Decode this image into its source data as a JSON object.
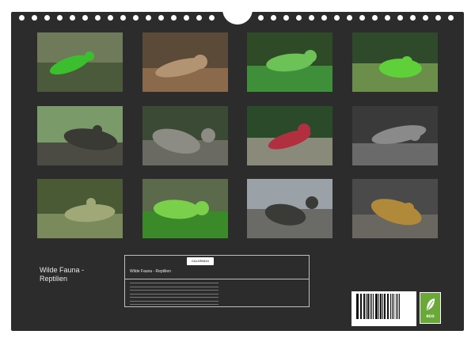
{
  "calendar": {
    "title_line1": "Wilde Fauna -",
    "title_line2": "Reptilien"
  },
  "photos": [
    {
      "caption": "",
      "subject": "green-gecko-on-branch",
      "palette": [
        "#6f7a5a",
        "#4a5a3a",
        "#3bbf2e"
      ]
    },
    {
      "caption": "",
      "subject": "tortoise-head",
      "palette": [
        "#5b4a38",
        "#8a6a4a",
        "#b39472"
      ]
    },
    {
      "caption": "",
      "subject": "green-iguana",
      "palette": [
        "#2f4a26",
        "#3f8f3a",
        "#6cc257"
      ]
    },
    {
      "caption": "",
      "subject": "green-lizard-on-leaf",
      "palette": [
        "#2e4a2a",
        "#6b8f4a",
        "#5fcf3a"
      ]
    },
    {
      "caption": "",
      "subject": "anole-on-rock",
      "palette": [
        "#7a9a6a",
        "#4b4b44",
        "#3a3a34"
      ]
    },
    {
      "caption": "",
      "subject": "alligator",
      "palette": [
        "#3a4a34",
        "#6a6a62",
        "#8c8c84"
      ]
    },
    {
      "caption": "",
      "subject": "iguana-in-flowers",
      "palette": [
        "#2a4a2a",
        "#8a8a7a",
        "#b03040"
      ]
    },
    {
      "caption": "",
      "subject": "lizard-on-lava",
      "palette": [
        "#3a3a3a",
        "#6a6a6a",
        "#8a8a8a"
      ]
    },
    {
      "caption": "",
      "subject": "iguana-portrait",
      "palette": [
        "#4a5a34",
        "#7a8a5a",
        "#a0a878"
      ]
    },
    {
      "caption": "",
      "subject": "green-anole",
      "palette": [
        "#5a6a4a",
        "#3a8a2a",
        "#7ad04a"
      ]
    },
    {
      "caption": "",
      "subject": "sea-turtle-beach",
      "palette": [
        "#9aa2a8",
        "#6a6a66",
        "#3a3a36"
      ]
    },
    {
      "caption": "",
      "subject": "lizard-on-lava-rock",
      "palette": [
        "#4a4a4a",
        "#6a6660",
        "#b08a3a"
      ]
    }
  ],
  "info": {
    "logo_text": "CALVENDO",
    "logo_sub": "",
    "title": "Wilde Fauna - Reptilien",
    "publisher_lines": []
  },
  "barcode": {
    "number": "",
    "pattern": [
      2,
      1,
      1,
      2,
      3,
      1,
      1,
      1,
      2,
      2,
      1,
      1,
      3,
      1,
      2,
      1,
      1,
      2,
      1,
      3,
      2,
      1,
      1,
      1,
      2,
      1,
      3,
      1,
      1,
      2,
      2,
      1,
      1,
      1,
      3,
      2,
      1,
      2,
      1,
      1,
      2,
      3,
      1,
      1,
      1,
      2,
      1,
      2
    ]
  },
  "eco_badge": {
    "text": "eco"
  }
}
